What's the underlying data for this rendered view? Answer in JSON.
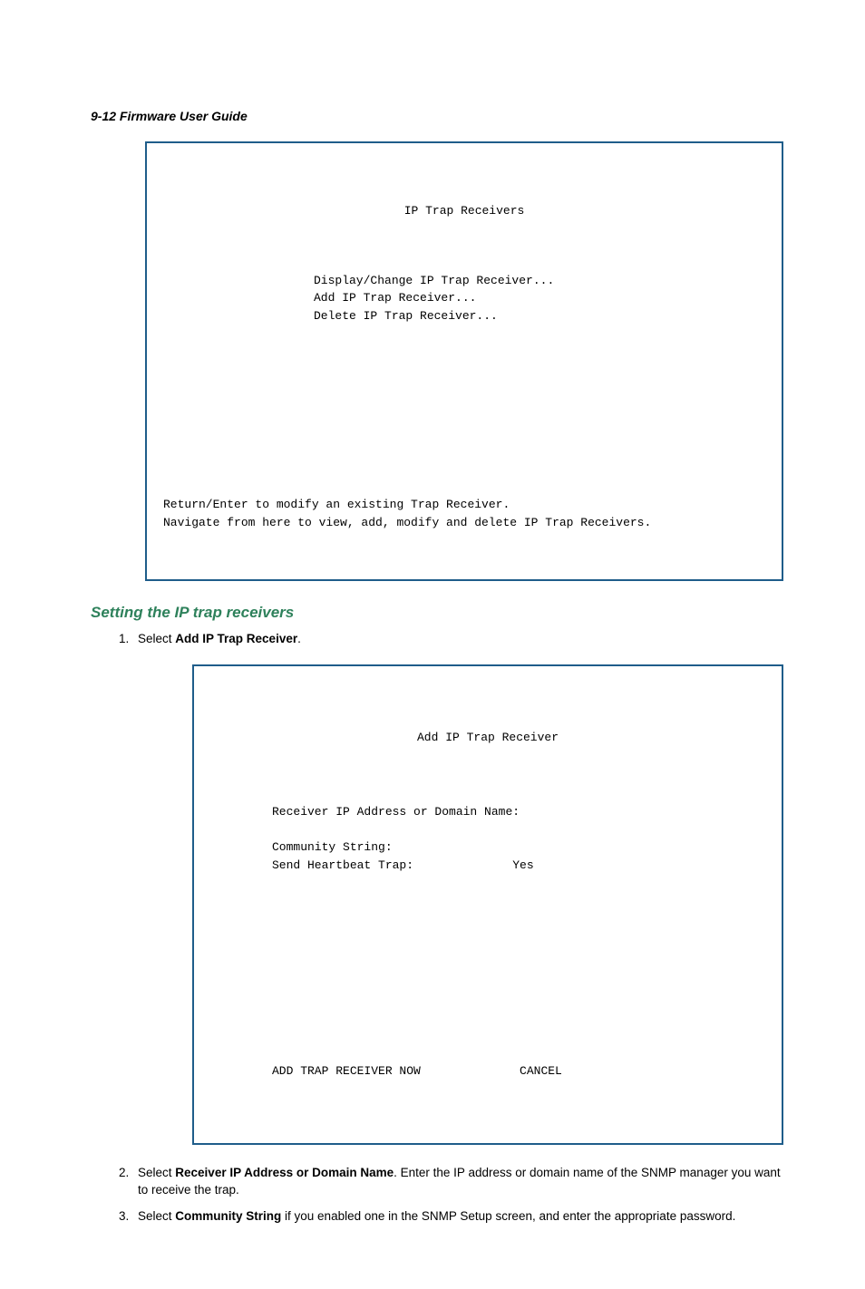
{
  "header": "9-12  Firmware User Guide",
  "terminal1": {
    "title": "IP Trap Receivers",
    "menu1": "Display/Change IP Trap Receiver...",
    "menu2": "Add IP Trap Receiver...",
    "menu3": "Delete IP Trap Receiver...",
    "footer1": "Return/Enter to modify an existing Trap Receiver.",
    "footer2": "Navigate from here to view, add, modify and delete IP Trap Receivers."
  },
  "sectionHeading": "Setting the IP trap receivers",
  "step1_prefix": "Select ",
  "step1_bold": "Add IP Trap Receiver",
  "step1_suffix": ".",
  "terminal2": {
    "title": "Add IP Trap Receiver",
    "field1": "Receiver IP Address or Domain Name:",
    "field2": "Community String:",
    "field3_label": "Send Heartbeat Trap:",
    "field3_value": "Yes",
    "action1": "ADD TRAP RECEIVER NOW",
    "action2": "CANCEL"
  },
  "step2_prefix": "Select ",
  "step2_bold": "Receiver IP Address or Domain Name",
  "step2_suffix": ". Enter the IP address or domain name of the SNMP manager you want to receive the trap.",
  "step3_prefix": "Select ",
  "step3_bold": "Community String",
  "step3_suffix": " if you enabled one in the SNMP Setup screen, and enter the appropriate password."
}
